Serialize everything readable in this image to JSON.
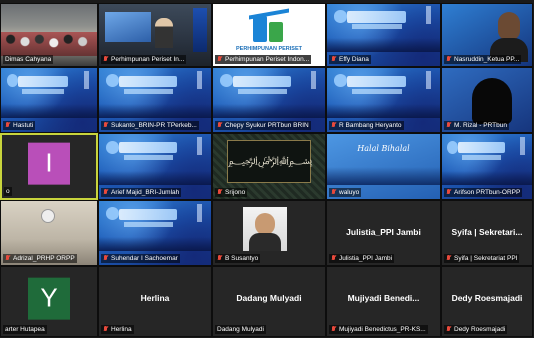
{
  "participants": [
    {
      "name": "Dimas Cahyana",
      "bg": "room"
    },
    {
      "name": "Perhimpunan Periset In...",
      "bg": "stage"
    },
    {
      "name": "Perhimpunan Periset Indon...",
      "bg": "logo"
    },
    {
      "name": "Effy Diana",
      "bg": "blue"
    },
    {
      "name": "Nasruddin_Ketua PP...",
      "bg": "face"
    },
    {
      "name": "Hastuti",
      "bg": "blue"
    },
    {
      "name": "Sukanto_BRIN-PR TPerkeb...",
      "bg": "blue"
    },
    {
      "name": "Chepy Syukur PRTbun BRIN",
      "bg": "blue"
    },
    {
      "name": "R Bambang Heryanto",
      "bg": "blue"
    },
    {
      "name": "M. Rizal - PRTbun",
      "bg": "silhouette"
    },
    {
      "name": "o",
      "bg": "avatar",
      "avatar_letter": "I",
      "avatar_color": "#b94fb9"
    },
    {
      "name": "Arief Majid_BRI-Jumlah",
      "bg": "blue"
    },
    {
      "name": "Srijono",
      "bg": "calligraphy"
    },
    {
      "name": "waluyo",
      "bg": "halal",
      "halal_text": "Halal Bihalal"
    },
    {
      "name": "Arifson PRTbun-ORPP",
      "bg": "blue"
    },
    {
      "name": "Adrizal_PRHP ORPP",
      "bg": "ceiling"
    },
    {
      "name": "Suhendar I Sachoemar",
      "bg": "blue"
    },
    {
      "name": "B Susantyo",
      "bg": "portrait"
    },
    {
      "name": "Julistia_PPI Jambi",
      "bg": "name",
      "display": "Julistia_PPI Jambi"
    },
    {
      "name": "Syifa | Sekretariat PPI",
      "bg": "name",
      "display": "Syifa | Sekretari..."
    },
    {
      "name": "arter Hutapea",
      "bg": "avatar",
      "avatar_letter": "Y",
      "avatar_color": "#1f6b3a"
    },
    {
      "name": "Herlina",
      "bg": "name",
      "display": "Herlina"
    },
    {
      "name": "Dadang Mulyadi",
      "bg": "name",
      "display": "Dadang Mulyadi"
    },
    {
      "name": "Mujiyadi Benedictus_PR-KS...",
      "bg": "name",
      "display": "Mujiyadi  Benedi..."
    },
    {
      "name": "Dedy Roesmajadi",
      "bg": "name",
      "display": "Dedy Roesmajadi"
    }
  ],
  "logo_text": "PERHIMPUNAN PERISET",
  "calligraphy_text": "﷽",
  "active_index": 10,
  "muted_indices": [
    1,
    2,
    3,
    4,
    5,
    6,
    7,
    8,
    9,
    11,
    12,
    13,
    14,
    15,
    16,
    17,
    18,
    19,
    21,
    23,
    24
  ]
}
